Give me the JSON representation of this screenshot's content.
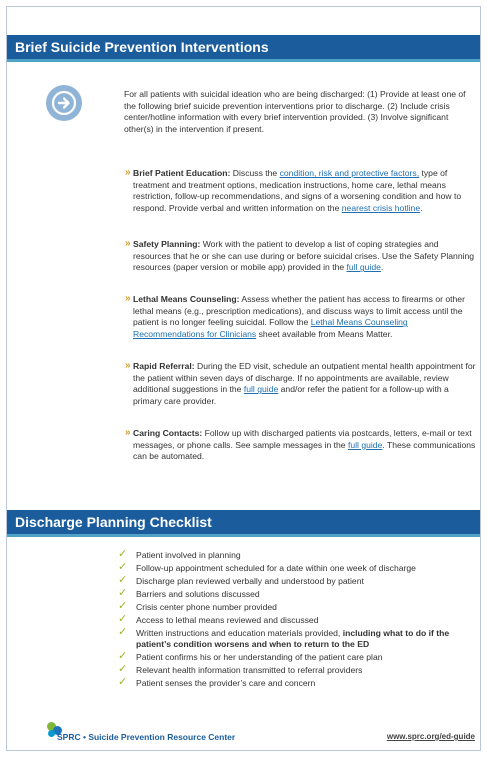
{
  "header": {
    "section1_title": "Brief Suicide Prevention Interventions",
    "section2_title": "Discharge Planning Checklist"
  },
  "intro": "For all patients with suicidal ideation who are being discharged: (1) Provide at least one of the following brief suicide prevention interventions prior to discharge. (2) Include crisis center/hotline information with every brief intervention provided. (3) Involve significant other(s) in the intervention if present.",
  "items": [
    {
      "title": "Brief Patient Education:",
      "t1": " Discuss the ",
      "link1": "condition, risk and protective factors,",
      "t2": " type of treatment and treatment options, medication instructions, home care, lethal means restriction, follow-up recommendations, and signs of a worsening condition and how to respond. Provide verbal and written information on the ",
      "link2": "nearest crisis hotline",
      "t3": "."
    },
    {
      "title": "Safety Planning:",
      "t1": " Work with the patient to develop a list of coping strategies and resources that he or she can use during or before suicidal crises. Use the Safety Planning resources (paper version or mobile app) provided in the ",
      "link1": "full guide",
      "t2": "."
    },
    {
      "title": "Lethal Means Counseling:",
      "t1": " Assess whether the patient has access to firearms or other lethal means (e.g., prescription medications), and discuss ways to limit access until the patient is no longer feeling suicidal. Follow the ",
      "link1": "Lethal Means Counseling Recommendations for Clinicians",
      "t2": " sheet available from Means Matter."
    },
    {
      "title": "Rapid Referral:",
      "t1": " During the ED visit, schedule an outpatient mental health appointment for the patient within seven days of discharge. If no appointments are available, review additional suggestions in the ",
      "link1": "full guide",
      "t2": " and/or refer the patient for a follow-up with a primary care provider."
    },
    {
      "title": "Caring Contacts:",
      "t1": " Follow up with discharged patients via postcards, letters, e-mail or text messages, or phone calls. See sample messages in the ",
      "link1": "full guide",
      "t2": ". These communications can be automated."
    }
  ],
  "checklist": [
    {
      "text": "Patient involved in planning"
    },
    {
      "text": "Follow-up appointment scheduled for a date within one week of discharge"
    },
    {
      "text": "Discharge plan reviewed verbally and understood by patient"
    },
    {
      "text": "Barriers and solutions discussed"
    },
    {
      "text": "Crisis center phone number provided"
    },
    {
      "text": "Access to lethal means reviewed and discussed"
    },
    {
      "text": "Written instructions and education materials provided, ",
      "bold": "including what to do if the patient’s condition worsens and when to return to the ED"
    },
    {
      "text": "Patient confirms his or her understanding of the patient care plan"
    },
    {
      "text": "Relevant health information transmitted to referral providers"
    },
    {
      "text": "Patient senses the provider’s care and concern"
    }
  ],
  "footer": {
    "org": "SPRC • Suicide Prevention Resource Center",
    "url": "www.sprc.org/ed-guide"
  },
  "colors": {
    "header_blue": "#1b5d9c",
    "teal": "#4fa3c7",
    "bullet_gold": "#d39a2a",
    "check_green": "#9bb52a",
    "link_blue": "#1f6fb0"
  },
  "icons": {
    "intro": "arrow-right-circle-icon",
    "bullet": "double-chevron-icon",
    "check": "checkmark-icon",
    "logo": "sprc-logo"
  }
}
